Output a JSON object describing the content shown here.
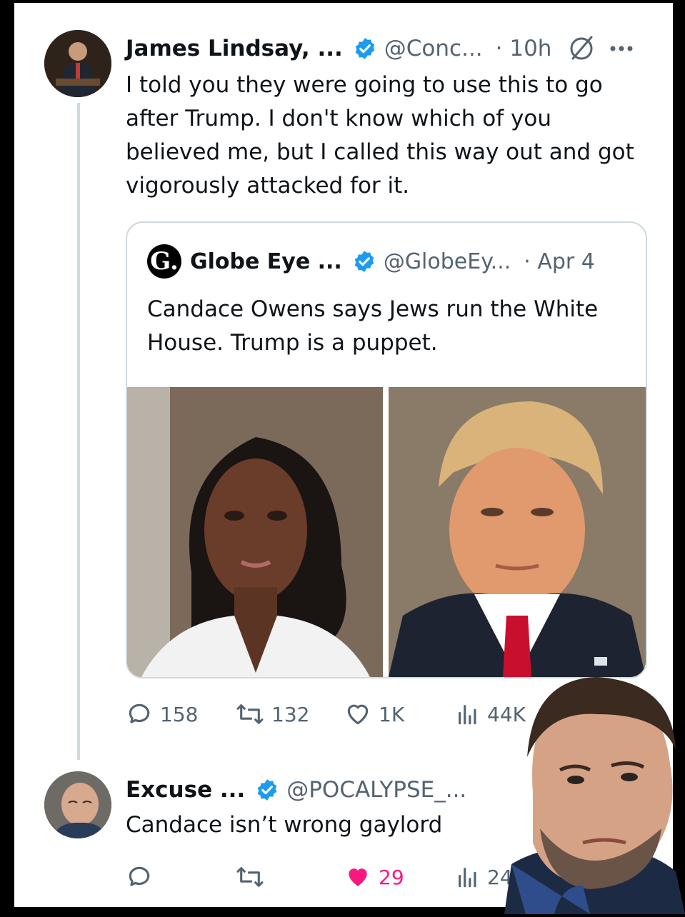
{
  "main_tweet": {
    "author_name": "James Lindsay, ...",
    "handle": "@Conc...",
    "time": "· 10h",
    "text": "I told you they were going to use this to go after Trump. I don't know which of you believed me, but I called this way out and got vigorously attacked for it.",
    "icons": [
      "verified-badge-icon",
      "grok-icon",
      "more-icon"
    ]
  },
  "quoted_tweet": {
    "author_name": "Globe Eye ...",
    "logo_letter": "G.",
    "handle": "@GlobeEy...",
    "time": "· Apr 4",
    "text": "Candace Owens says Jews run the White House. Trump is a puppet."
  },
  "main_metrics": {
    "replies": "158",
    "reposts": "132",
    "likes": "1K",
    "views": "44K"
  },
  "reply_tweet": {
    "author_name": "Excuse ...",
    "handle": "@POCALYPSE_...",
    "text": "Candace isn’t wrong gaylord",
    "likes": "29",
    "views": "246"
  },
  "colors": {
    "verified": "#1d9bf0",
    "like_active": "#f91880",
    "muted": "#536471",
    "border": "#cfd9de"
  }
}
